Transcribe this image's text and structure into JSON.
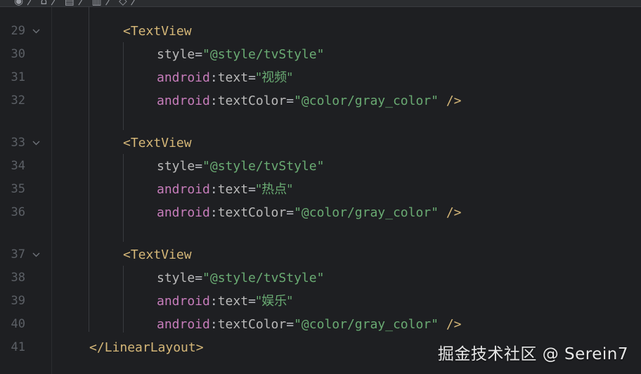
{
  "top_breadcrumb": "◉ 〉 ⌂ 〉 ▤ 〉 ▥ 〉 ◇ 〉",
  "lines": [
    {
      "number": "29",
      "fold": true,
      "indent": "tag",
      "tokens": {
        "open": "<",
        "name": "TextView"
      }
    },
    {
      "number": "30",
      "fold": false,
      "indent": "attr",
      "tokens": {
        "attr": "style",
        "eq": "=",
        "value": "\"@style/tvStyle\""
      }
    },
    {
      "number": "31",
      "fold": false,
      "indent": "attr",
      "tokens": {
        "ns": "android",
        "colon": ":",
        "attr": "text",
        "eq": "=",
        "value": "\"视频\""
      }
    },
    {
      "number": "32",
      "fold": false,
      "indent": "attr",
      "tokens": {
        "ns": "android",
        "colon": ":",
        "attr": "textColor",
        "eq": "=",
        "value": "\"@color/gray_color\"",
        "close": " />"
      }
    },
    {
      "number": "33",
      "fold": true,
      "indent": "tag",
      "tokens": {
        "open": "<",
        "name": "TextView"
      }
    },
    {
      "number": "34",
      "fold": false,
      "indent": "attr",
      "tokens": {
        "attr": "style",
        "eq": "=",
        "value": "\"@style/tvStyle\""
      }
    },
    {
      "number": "35",
      "fold": false,
      "indent": "attr",
      "tokens": {
        "ns": "android",
        "colon": ":",
        "attr": "text",
        "eq": "=",
        "value": "\"热点\""
      }
    },
    {
      "number": "36",
      "fold": false,
      "indent": "attr",
      "tokens": {
        "ns": "android",
        "colon": ":",
        "attr": "textColor",
        "eq": "=",
        "value": "\"@color/gray_color\"",
        "close": " />"
      }
    },
    {
      "number": "37",
      "fold": true,
      "indent": "tag",
      "tokens": {
        "open": "<",
        "name": "TextView"
      }
    },
    {
      "number": "38",
      "fold": false,
      "indent": "attr",
      "tokens": {
        "attr": "style",
        "eq": "=",
        "value": "\"@style/tvStyle\""
      }
    },
    {
      "number": "39",
      "fold": false,
      "indent": "attr",
      "tokens": {
        "ns": "android",
        "colon": ":",
        "attr": "text",
        "eq": "=",
        "value": "\"娱乐\""
      }
    },
    {
      "number": "40",
      "fold": false,
      "indent": "attr",
      "tokens": {
        "ns": "android",
        "colon": ":",
        "attr": "textColor",
        "eq": "=",
        "value": "\"@color/gray_color\"",
        "close": " />"
      }
    },
    {
      "number": "41",
      "fold": false,
      "indent": "close",
      "tokens": {
        "open": "</",
        "name": "LinearLayout",
        "end": ">"
      }
    }
  ],
  "watermark": "掘金技术社区 @ Serein7",
  "colors": {
    "background": "#1e1f22",
    "tag": "#d5b778",
    "namespace": "#c77dbb",
    "attribute": "#bababa",
    "string": "#6aab73",
    "line_number": "#5c6066"
  }
}
